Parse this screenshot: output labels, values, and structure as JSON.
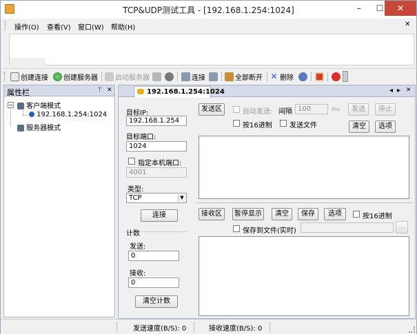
{
  "window": {
    "title": "TCP&UDP测试工具 - [192.168.1.254:1024]",
    "minimize": "–",
    "maximize": "☐",
    "close": "✕",
    "inner_close": "✕"
  },
  "menu": [
    "操作(O)",
    "查看(V)",
    "窗口(W)",
    "帮助(H)"
  ],
  "toolbar": {
    "create_connection": "创建连接",
    "create_server": "创建服务器",
    "start_server": "启动服务器",
    "connect": "连接",
    "disconnect_all": "全部断开",
    "delete": "删除"
  },
  "left_panel": {
    "title": "属性栏",
    "pin": "ᛘ",
    "close": "✕",
    "client_mode": "客户端模式",
    "client_item": "192.168.1.254:1024",
    "server_mode": "服务器模式",
    "expand_sign": "−"
  },
  "tab": {
    "label": "192.168.1.254:1024",
    "nav_prev": "◂",
    "nav_next": "▸",
    "close": "✕"
  },
  "connection": {
    "target_ip_label": "目标IP:",
    "target_ip": "192.168.1.254",
    "target_port_label": "目标端口:",
    "target_port": "1024",
    "local_port_label": "指定本机端口:",
    "local_port": "4001",
    "type_label": "类型:",
    "type_value": "TCP",
    "connect_button": "连接"
  },
  "counter": {
    "title": "计数",
    "send_label": "发送:",
    "send_value": "0",
    "recv_label": "接收:",
    "recv_value": "0",
    "clear_button": "清空计数"
  },
  "send_area": {
    "title": "发送区",
    "auto_send": "自动发送:",
    "interval_label": "间隔",
    "interval_value": "100",
    "unit": "ms",
    "send_button": "发送",
    "stop_button": "停止",
    "hex_label": "按16进制",
    "send_file_label": "发送文件",
    "clear_button": "清空",
    "options_button": "选项"
  },
  "recv_area": {
    "title": "接收区",
    "pause_button": "暂停显示",
    "clear_button": "清空",
    "save_button": "保存",
    "options_button": "选项",
    "hex_label": "按16进制",
    "save_file_label": "保存到文件(实时)",
    "browse_button": "..."
  },
  "status": {
    "send_speed": "发送速度(B/S): 0",
    "recv_speed": "接收速度(B/S): 0"
  },
  "colors": {
    "accent": "#3c6ec8",
    "close_red": "#c7473a"
  }
}
